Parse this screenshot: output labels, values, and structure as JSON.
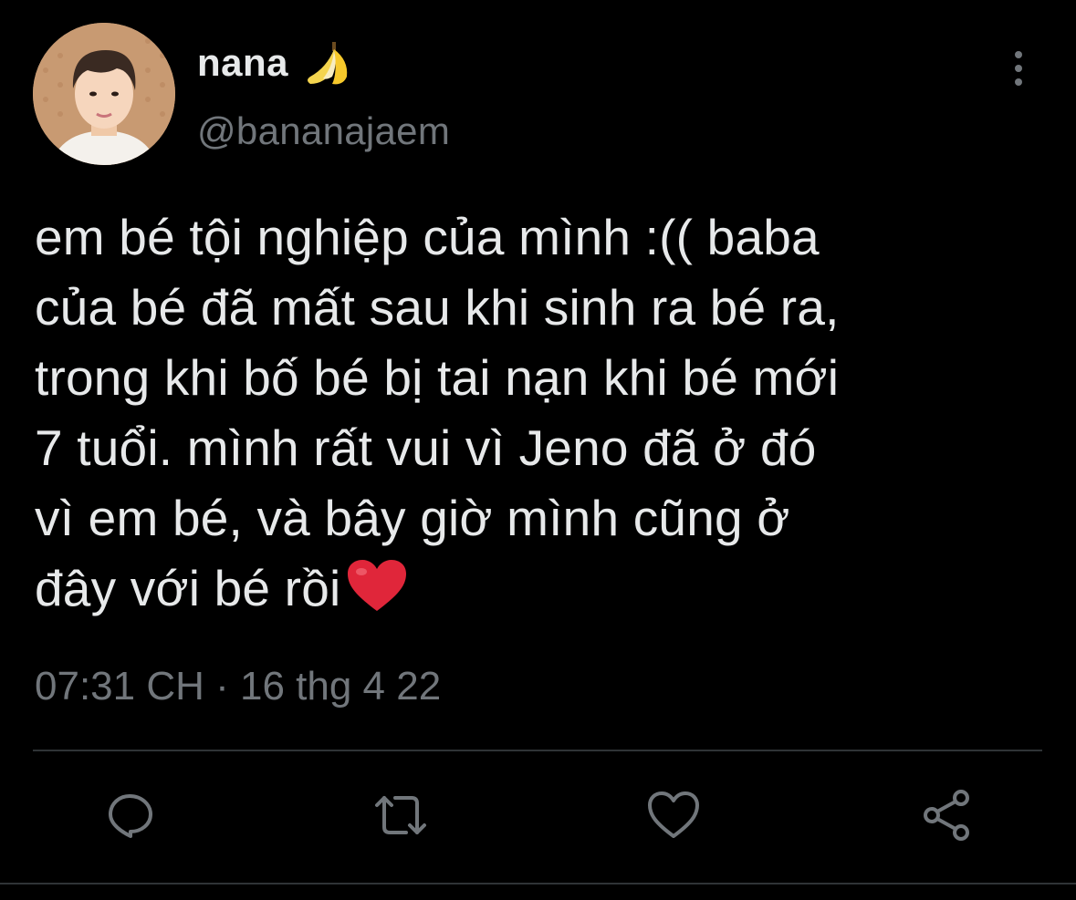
{
  "tweet": {
    "author": {
      "display_name": "nana",
      "name_emoji": "banana-icon",
      "handle": "@bananajaem"
    },
    "text_lines": [
      "em bé tội nghiệp của mình :(( baba",
      "của bé đã mất sau khi sinh ra bé ra,",
      "trong khi bố bé bị tai nạn khi bé mới",
      "7 tuổi. mình rất vui vì Jeno đã ở đó",
      "vì em bé, và bây giờ mình cũng ở",
      "đây với bé rồi"
    ],
    "trailing_emoji": "red-heart-icon",
    "timestamp": "07:31 CH · 16 thg 4 22"
  },
  "actions": [
    {
      "icon": "reply-icon"
    },
    {
      "icon": "retweet-icon"
    },
    {
      "icon": "like-icon"
    },
    {
      "icon": "share-icon"
    }
  ],
  "colors": {
    "background": "#000000",
    "primary_text": "#e7e9ea",
    "secondary_text": "#71767b",
    "divider": "#2f3336",
    "heart": "#e0263a"
  }
}
